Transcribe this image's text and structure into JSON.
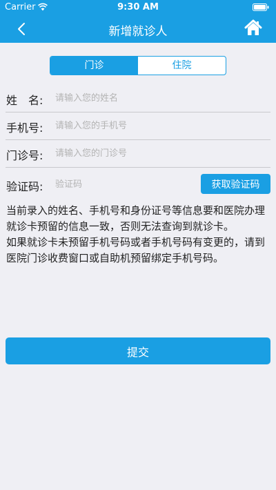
{
  "status_bar": {
    "carrier": "Carrier",
    "time": "9:30 AM"
  },
  "header": {
    "title": "新增就诊人",
    "back_icon": "chevron-left-icon",
    "home_icon": "home-icon"
  },
  "tabs": [
    {
      "label": "门诊",
      "active": true
    },
    {
      "label": "住院",
      "active": false
    }
  ],
  "form": {
    "name": {
      "label": "姓　名:",
      "placeholder": "请输入您的姓名",
      "value": ""
    },
    "phone": {
      "label": "手机号:",
      "placeholder": "请输入您的手机号",
      "value": ""
    },
    "clinic_no": {
      "label": "门诊号:",
      "placeholder": "请输入您的门诊号",
      "value": ""
    },
    "code": {
      "label": "验证码:",
      "placeholder": "验证码",
      "value": "",
      "button_label": "获取验证码"
    }
  },
  "notice": {
    "paragraph1": "当前录入的姓名、手机号和身份证号等信息要和医院办理就诊卡预留的信息一致，否则无法查询到就诊卡。",
    "paragraph2": "如果就诊卡未预留手机号码或者手机号码有变更的，请到医院门诊收费窗口或自助机预留绑定手机号码。"
  },
  "submit_label": "提交",
  "colors": {
    "accent": "#1a9fe3",
    "background": "#efeff4"
  }
}
